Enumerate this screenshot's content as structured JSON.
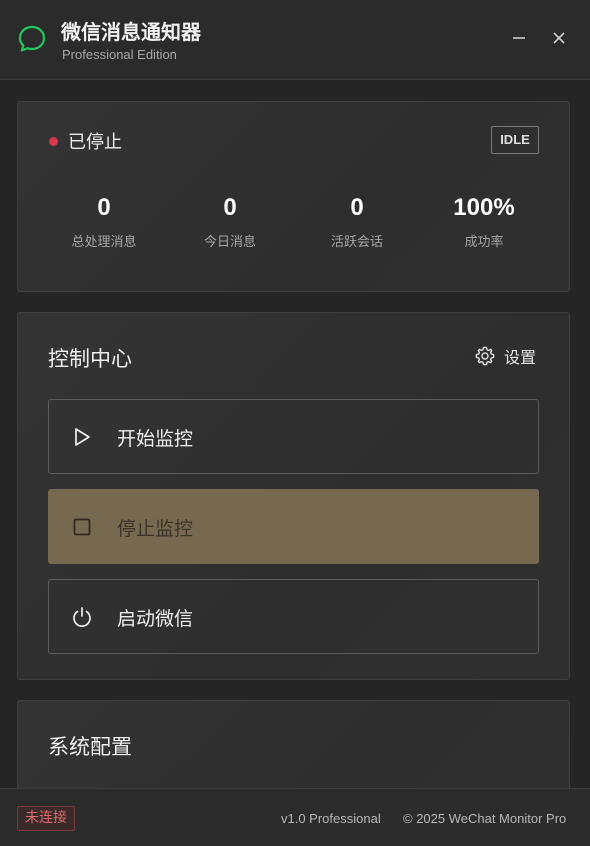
{
  "app": {
    "title": "微信消息通知器",
    "subtitle": "Professional Edition",
    "logo_icon": "chat-bubble-icon",
    "accent_color": "#22c55e"
  },
  "window_controls": {
    "minimize_icon": "minimize-icon",
    "close_icon": "close-icon"
  },
  "status": {
    "text": "已停止",
    "indicator_color": "#d9364d",
    "badge": "IDLE",
    "stats": [
      {
        "value": "0",
        "label": "总处理消息"
      },
      {
        "value": "0",
        "label": "今日消息"
      },
      {
        "value": "0",
        "label": "活跃会话"
      },
      {
        "value": "100%",
        "label": "成功率"
      }
    ]
  },
  "control": {
    "title": "控制中心",
    "settings_label": "设置",
    "settings_icon": "gear-icon",
    "buttons": [
      {
        "label": "开始监控",
        "icon": "play-icon"
      },
      {
        "label": "停止监控",
        "icon": "stop-icon",
        "color": "#77694f"
      },
      {
        "label": "启动微信",
        "icon": "power-icon"
      }
    ]
  },
  "config": {
    "title": "系统配置"
  },
  "footer": {
    "connection": "未连接",
    "version": "v1.0 Professional",
    "copyright": "© 2025 WeChat Monitor Pro"
  }
}
